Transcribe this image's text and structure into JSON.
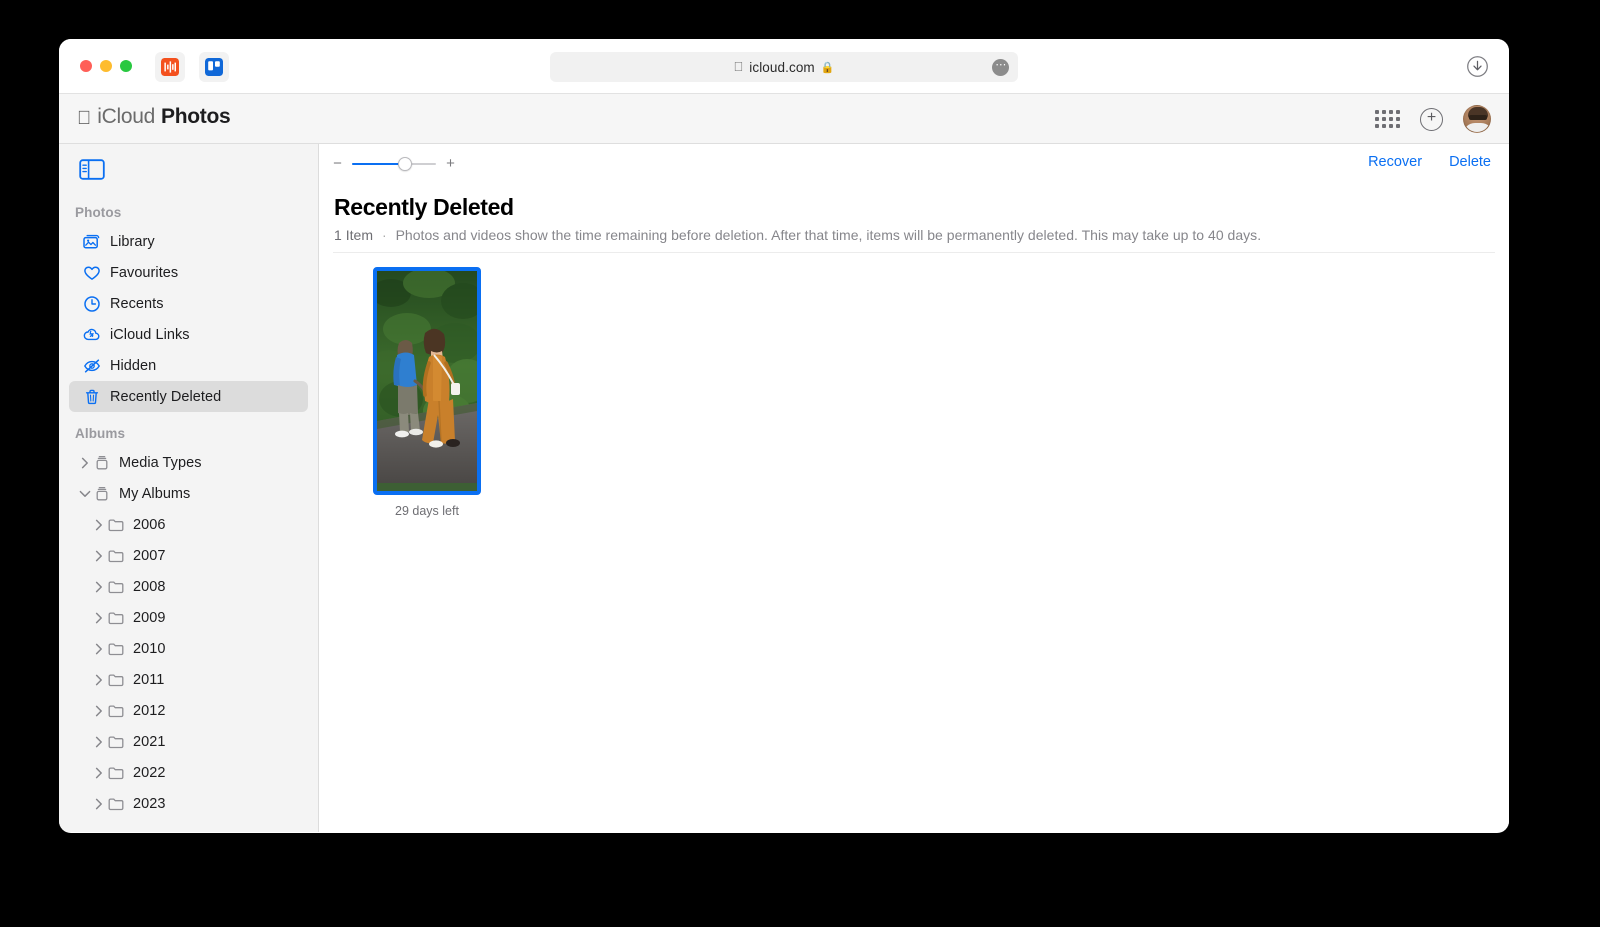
{
  "browser": {
    "window_controls": [
      "close",
      "minimize",
      "zoom"
    ],
    "extensions": [
      {
        "name": "audio-extension-icon",
        "color": "#f4511e"
      },
      {
        "name": "board-extension-icon",
        "color": "#1068d8"
      }
    ],
    "url": "icloud.com",
    "url_lock_icon": "lock-icon",
    "url_apple_icon": "apple-icon",
    "url_more_icon": "more-options-icon",
    "download_icon": "download-icon"
  },
  "app_header": {
    "apple_logo": "apple-logo-icon",
    "icloud_label": "iCloud",
    "app_name": "Photos",
    "grid_icon": "app-grid-icon",
    "plus_icon": "plus-circle-icon",
    "avatar": "user-avatar"
  },
  "sidebar": {
    "toggle_icon": "sidebar-toggle-icon",
    "sections": [
      {
        "title": "Photos",
        "items": [
          {
            "label": "Library",
            "icon": "library-icon",
            "selected": false
          },
          {
            "label": "Favourites",
            "icon": "heart-icon",
            "selected": false
          },
          {
            "label": "Recents",
            "icon": "clock-icon",
            "selected": false
          },
          {
            "label": "iCloud Links",
            "icon": "cloud-link-icon",
            "selected": false
          },
          {
            "label": "Hidden",
            "icon": "eye-slash-icon",
            "selected": false
          },
          {
            "label": "Recently Deleted",
            "icon": "trash-icon",
            "selected": true
          }
        ]
      },
      {
        "title": "Albums",
        "items": [
          {
            "label": "Media Types",
            "icon": "album-stack-icon",
            "expanded": false,
            "level": 0
          },
          {
            "label": "My Albums",
            "icon": "album-stack-icon",
            "expanded": true,
            "level": 0
          },
          {
            "label": "2006",
            "icon": "folder-icon",
            "expanded": false,
            "level": 1
          },
          {
            "label": "2007",
            "icon": "folder-icon",
            "expanded": false,
            "level": 1
          },
          {
            "label": "2008",
            "icon": "folder-icon",
            "expanded": false,
            "level": 1
          },
          {
            "label": "2009",
            "icon": "folder-icon",
            "expanded": false,
            "level": 1
          },
          {
            "label": "2010",
            "icon": "folder-icon",
            "expanded": false,
            "level": 1
          },
          {
            "label": "2011",
            "icon": "folder-icon",
            "expanded": false,
            "level": 1
          },
          {
            "label": "2012",
            "icon": "folder-icon",
            "expanded": false,
            "level": 1
          },
          {
            "label": "2021",
            "icon": "folder-icon",
            "expanded": false,
            "level": 1
          },
          {
            "label": "2022",
            "icon": "folder-icon",
            "expanded": false,
            "level": 1
          },
          {
            "label": "2023",
            "icon": "folder-icon",
            "expanded": false,
            "level": 1
          }
        ]
      }
    ]
  },
  "main": {
    "zoom_minus": "−",
    "zoom_plus": "+",
    "zoom_value_percent": 62,
    "recover_label": "Recover",
    "delete_label": "Delete",
    "title": "Recently Deleted",
    "item_count": "1 Item",
    "separator": "·",
    "description": "Photos and videos show the time remaining before deletion. After that time, items will be permanently deleted. This may take up to 40 days.",
    "photos": [
      {
        "caption": "29 days left",
        "selected": true,
        "alt": "two people walking on a path, one in an orange jumpsuit"
      }
    ]
  },
  "colors": {
    "accent": "#0a6ff2",
    "selection": "#dcdcdc",
    "sidebar_bg": "#f4f4f4",
    "header_bg": "#f6f6f6"
  }
}
